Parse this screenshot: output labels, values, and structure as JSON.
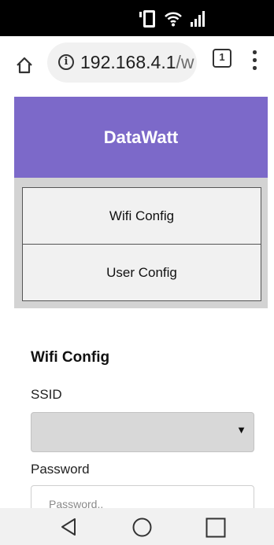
{
  "browser": {
    "url_host": "192.168.4.1",
    "url_path_visible": "/w",
    "tab_count": "1"
  },
  "page": {
    "title": "DataWatt",
    "nav": [
      {
        "label": "Wifi Config"
      },
      {
        "label": "User Config"
      }
    ],
    "section_title": "Wifi Config",
    "ssid_label": "SSID",
    "ssid_value": "",
    "password_label": "Password",
    "password_placeholder": "Password.."
  },
  "colors": {
    "header_bg": "#7c69c9",
    "nav_panel_bg": "#d3d3d3",
    "nav_button_bg": "#f1f1f1",
    "status_bar_bg": "#000000"
  },
  "icons": {
    "status": [
      "phone-vibrate-icon",
      "wifi-icon",
      "signal-icon"
    ],
    "toolbar": [
      "home-icon",
      "info-icon",
      "tabs-icon",
      "overflow-menu-icon"
    ],
    "navigation": [
      "back-icon",
      "home-circle-icon",
      "recents-icon"
    ]
  }
}
